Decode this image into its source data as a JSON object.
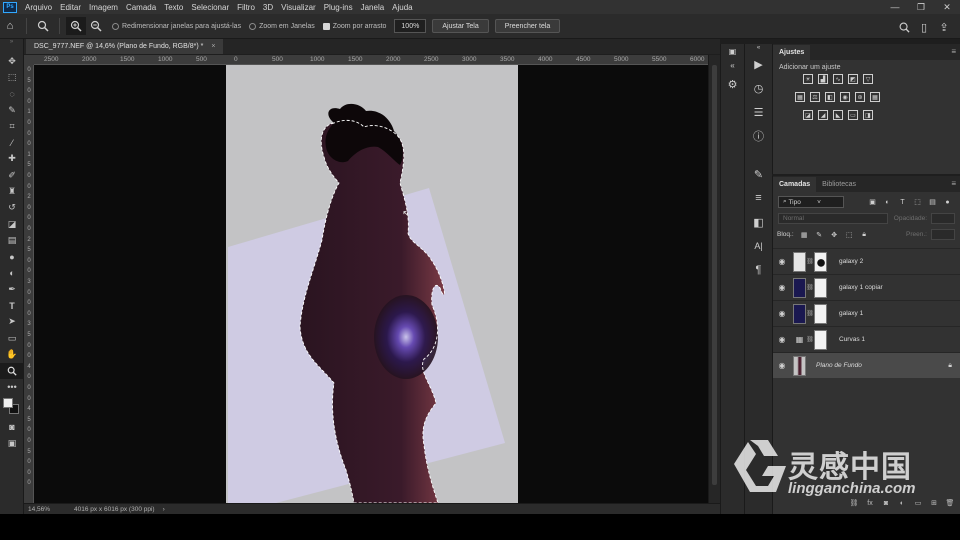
{
  "app": {
    "logo_text": "Ps"
  },
  "menu": [
    "Arquivo",
    "Editar",
    "Imagem",
    "Camada",
    "Texto",
    "Selecionar",
    "Filtro",
    "3D",
    "Visualizar",
    "Plug-ins",
    "Janela",
    "Ajuda"
  ],
  "window_controls": {
    "minimize": "—",
    "restore": "❐",
    "close": "✕"
  },
  "options": {
    "resize_windows": "Redimensionar janelas para ajustá-las",
    "zoom_all": "Zoom em Janelas",
    "scrubby_zoom": "Zoom por arrasto",
    "zoom_value": "100%",
    "fit_screen": "Ajustar Tela",
    "fill_screen": "Preencher tela"
  },
  "document": {
    "tab_title": "DSC_9777.NEF @ 14,6% (Plano de Fundo, RGB/8*) *",
    "close": "×"
  },
  "ruler": {
    "h_ticks": [
      "2500",
      "2000",
      "1500",
      "1000",
      "500",
      "0",
      "500",
      "1000",
      "1500",
      "2000",
      "2500",
      "3000",
      "3500",
      "4000",
      "4500",
      "5000",
      "5500",
      "6000",
      "650"
    ],
    "v_ticks": [
      "0",
      "5",
      "0",
      "0",
      "1",
      "0",
      "0",
      "0",
      "1",
      "5",
      "0",
      "0",
      "2",
      "0",
      "0",
      "0",
      "2",
      "5",
      "0",
      "0",
      "3",
      "0",
      "0",
      "0",
      "3",
      "5",
      "0",
      "0",
      "4",
      "0",
      "0",
      "0",
      "4",
      "5",
      "0",
      "0",
      "5",
      "0",
      "0",
      "0"
    ]
  },
  "status": {
    "zoom": "14,56%",
    "info": "4016 px x 6016 px (300 ppi)",
    "arrow": "›"
  },
  "adjustments": {
    "tab": "Ajustes",
    "add_label": "Adicionar um ajuste"
  },
  "layers_panel": {
    "tabs": [
      "Camadas",
      "Bibliotecas"
    ],
    "kind": "Tipo",
    "blend_mode": "Normal",
    "opacity_label": "Opacidade:",
    "lock_label": "Bloq.:",
    "fill_label": "Preen.:",
    "layers": [
      {
        "name": "galaxy 2",
        "type": "pixel-mask",
        "selected": false
      },
      {
        "name": "galaxy 1 copiar",
        "type": "pixel-mask",
        "selected": false
      },
      {
        "name": "galaxy 1",
        "type": "pixel-mask",
        "selected": false
      },
      {
        "name": "Curvas 1",
        "type": "adjustment",
        "selected": false
      },
      {
        "name": "Plano de Fundo",
        "type": "background",
        "selected": true
      }
    ]
  },
  "watermark": {
    "chinese": "灵感中国",
    "url": "lingganchina.com"
  },
  "colors": {
    "accent": "#31a8ff",
    "canvas_bg": "#0b0b0b",
    "panel_bg": "#323232"
  }
}
